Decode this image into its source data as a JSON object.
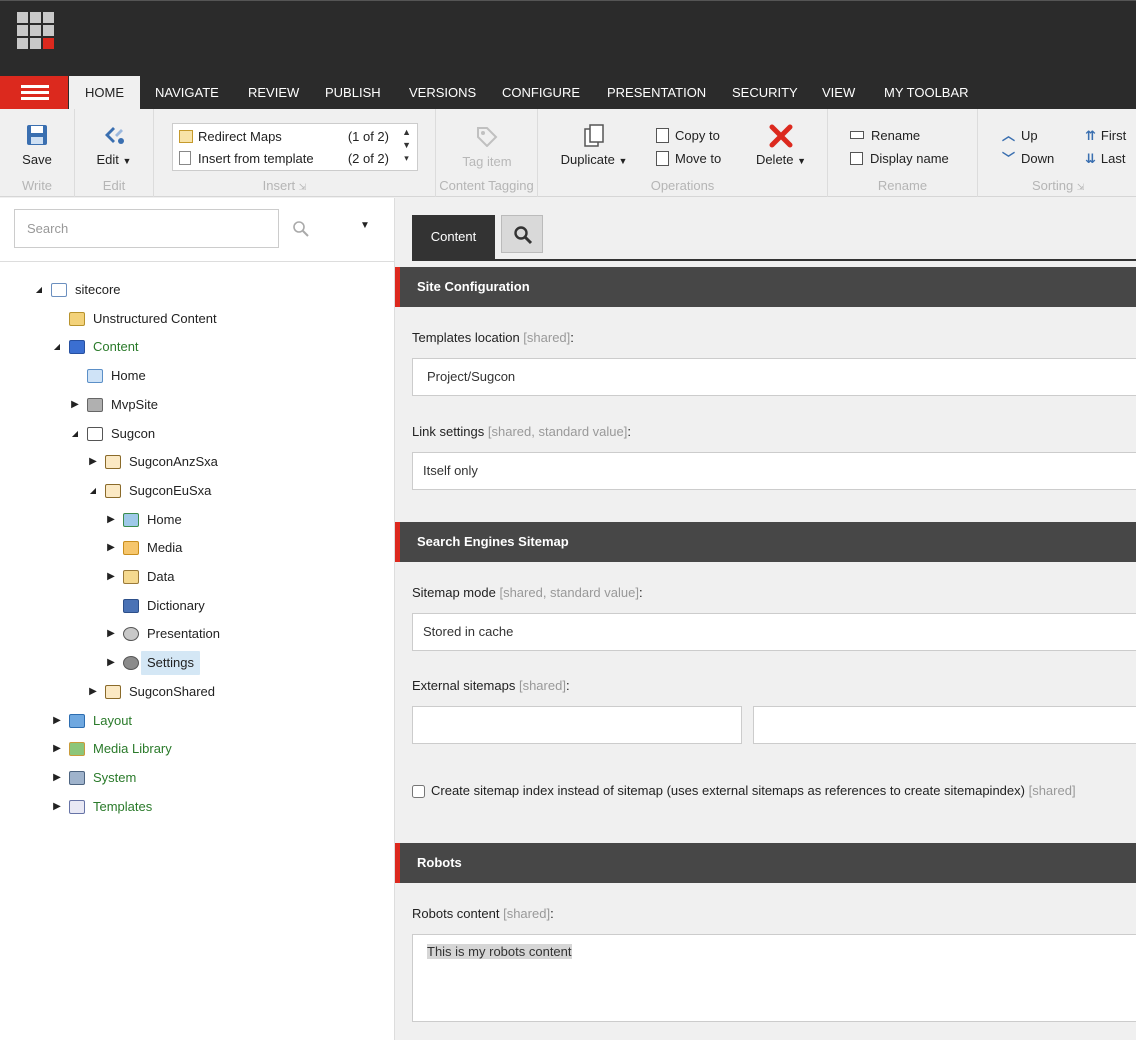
{
  "tabs": [
    {
      "label": "HOME",
      "active": true
    },
    {
      "label": "NAVIGATE"
    },
    {
      "label": "REVIEW"
    },
    {
      "label": "PUBLISH"
    },
    {
      "label": "VERSIONS"
    },
    {
      "label": "CONFIGURE"
    },
    {
      "label": "PRESENTATION"
    },
    {
      "label": "SECURITY"
    },
    {
      "label": "VIEW"
    },
    {
      "label": "MY TOOLBAR"
    }
  ],
  "ribbon": {
    "write": {
      "title": "Write",
      "save": "Save"
    },
    "edit": {
      "title": "Edit",
      "edit": "Edit"
    },
    "insert": {
      "title": "Insert",
      "items": [
        {
          "label": "Redirect Maps",
          "count": "(1 of 2)"
        },
        {
          "label": "Insert from template",
          "count": "(2 of 2)"
        }
      ]
    },
    "tagging": {
      "title": "Content Tagging",
      "tag_item": "Tag item"
    },
    "operations": {
      "title": "Operations",
      "duplicate": "Duplicate",
      "copy_to": "Copy to",
      "move_to": "Move to",
      "delete": "Delete"
    },
    "rename": {
      "title": "Rename",
      "rename": "Rename",
      "display_name": "Display name"
    },
    "sorting": {
      "title": "Sorting",
      "up": "Up",
      "down": "Down",
      "first": "First",
      "last": "Last"
    }
  },
  "search": {
    "placeholder": "Search"
  },
  "tree": [
    {
      "label": "sitecore",
      "depth": 0,
      "arrow": "open",
      "icon": "document-icon",
      "green": false
    },
    {
      "label": "Unstructured Content",
      "depth": 1,
      "arrow": "none",
      "icon": "folder-icon",
      "green": false
    },
    {
      "label": "Content",
      "depth": 1,
      "arrow": "open",
      "icon": "cubes-icon",
      "green": true
    },
    {
      "label": "Home",
      "depth": 2,
      "arrow": "none",
      "icon": "home-icon",
      "green": false
    },
    {
      "label": "MvpSite",
      "depth": 2,
      "arrow": "closed",
      "icon": "building-icon",
      "green": false
    },
    {
      "label": "Sugcon",
      "depth": 2,
      "arrow": "open",
      "icon": "window-icon",
      "green": false
    },
    {
      "label": "SugconAnzSxa",
      "depth": 3,
      "arrow": "closed",
      "icon": "site-icon",
      "green": false
    },
    {
      "label": "SugconEuSxa",
      "depth": 3,
      "arrow": "open",
      "icon": "site-icon",
      "green": false
    },
    {
      "label": "Home",
      "depth": 4,
      "arrow": "closed",
      "icon": "sign-icon",
      "green": false
    },
    {
      "label": "Media",
      "depth": 4,
      "arrow": "closed",
      "icon": "media-folder-icon",
      "green": false
    },
    {
      "label": "Data",
      "depth": 4,
      "arrow": "closed",
      "icon": "data-icon",
      "green": false
    },
    {
      "label": "Dictionary",
      "depth": 4,
      "arrow": "none",
      "icon": "book-icon",
      "green": false
    },
    {
      "label": "Presentation",
      "depth": 4,
      "arrow": "closed",
      "icon": "eye-icon",
      "green": false
    },
    {
      "label": "Settings",
      "depth": 4,
      "arrow": "closed",
      "icon": "gears-icon",
      "green": false,
      "selected": true
    },
    {
      "label": "SugconShared",
      "depth": 3,
      "arrow": "closed",
      "icon": "site-icon",
      "green": false
    },
    {
      "label": "Layout",
      "depth": 1,
      "arrow": "closed",
      "icon": "layout-icon",
      "green": true
    },
    {
      "label": "Media Library",
      "depth": 1,
      "arrow": "closed",
      "icon": "picture-icon",
      "green": true
    },
    {
      "label": "System",
      "depth": 1,
      "arrow": "closed",
      "icon": "system-icon",
      "green": true
    },
    {
      "label": "Templates",
      "depth": 1,
      "arrow": "closed",
      "icon": "template-icon",
      "green": true
    }
  ],
  "editor": {
    "content_tab": "Content",
    "sections": {
      "site_config": "Site Configuration",
      "sitemap": "Search Engines Sitemap",
      "robots": "Robots"
    },
    "fields": {
      "templates_location": {
        "label": "Templates location",
        "meta": "[shared]",
        "value": "Project/Sugcon"
      },
      "link_settings": {
        "label": "Link settings",
        "meta": "[shared, standard value]",
        "value": "Itself only"
      },
      "sitemap_mode": {
        "label": "Sitemap mode",
        "meta": "[shared, standard value]",
        "value": "Stored in cache"
      },
      "external_sitemaps": {
        "label": "External sitemaps",
        "meta": "[shared]"
      },
      "sitemap_index": {
        "label": "Create sitemap index instead of sitemap (uses external sitemaps as references to create sitemapindex)",
        "meta": "[shared]",
        "checked": false
      },
      "robots_content": {
        "label": "Robots content",
        "meta": "[shared]",
        "value": "This is my robots content"
      }
    }
  }
}
